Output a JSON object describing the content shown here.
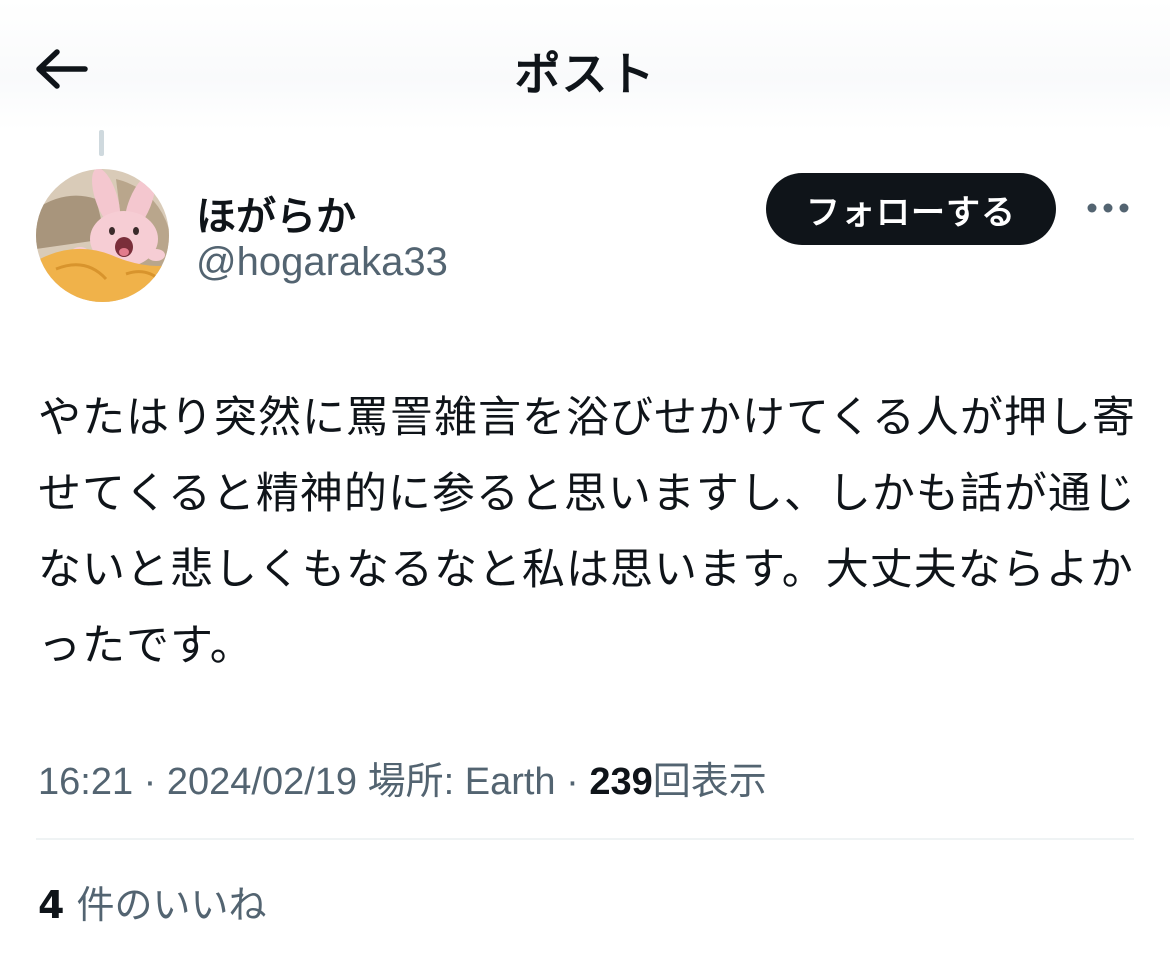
{
  "header": {
    "title": "ポスト"
  },
  "author": {
    "display_name": "ほがらか",
    "handle": "@hogaraka33",
    "avatar_icon": "rabbit-avatar"
  },
  "actions": {
    "follow_label": "フォローする",
    "more_icon": "ellipsis-icon"
  },
  "post": {
    "text": "やたはり突然に罵詈雑言を浴びせかけてくる人が押し寄せてくると精神的に参ると思いますし、しかも話が通じないと悲しくもなるなと私は思います。大丈夫ならよかったです。"
  },
  "meta": {
    "time": "16:21",
    "separator": "·",
    "date": "2024/02/19",
    "location_label": "場所: Earth",
    "view_count": "239",
    "view_label": "回表示"
  },
  "likes": {
    "count": "4",
    "label": "件のいいね"
  },
  "colors": {
    "text_primary": "#0f1419",
    "text_secondary": "#536471",
    "follow_bg": "#0f1419",
    "divider": "#eff3f4"
  }
}
